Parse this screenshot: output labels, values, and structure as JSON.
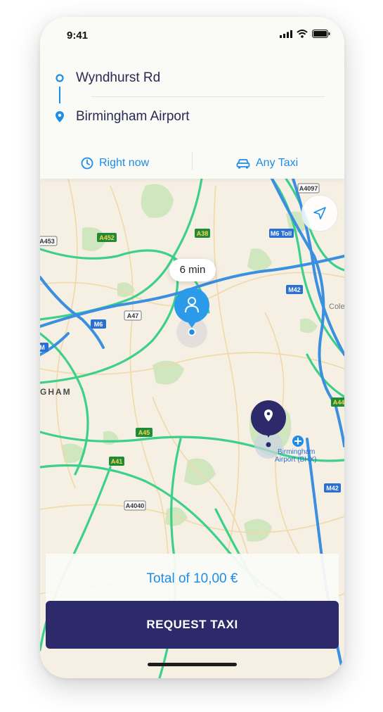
{
  "status_bar": {
    "time": "9:41"
  },
  "route": {
    "origin": "Wyndhurst Rd",
    "destination": "Birmingham Airport"
  },
  "options": {
    "time_label": "Right now",
    "taxi_label": "Any Taxi"
  },
  "map": {
    "eta_label": "6 min",
    "place_label_line1": "Birmingham",
    "place_label_line2": "Airport (BHX)",
    "city_label": "GHAM",
    "edge_label": "Cole",
    "road_labels": [
      "A4097",
      "A452",
      "A38",
      "M6 Toll",
      "A453",
      "A47",
      "M6",
      "M42",
      "A45",
      "A41",
      "A4040",
      "A44",
      "M"
    ]
  },
  "colors": {
    "accent_blue": "#1e8de6",
    "navy": "#2d2a6c",
    "motorway": "#3a8fe0",
    "green_road": "#3cd08a"
  },
  "footer": {
    "total_text": "Total of 10,00 €",
    "request_button": "REQUEST TAXI"
  }
}
